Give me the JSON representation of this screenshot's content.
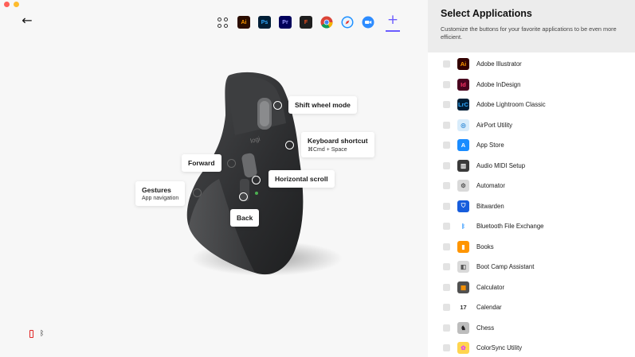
{
  "toolbar": {
    "back_label": "←",
    "apps": [
      {
        "name": "all-apps",
        "glyph": ""
      },
      {
        "name": "illustrator",
        "glyph": "Ai",
        "color": "#2b0d00",
        "fg": "#ff9a00"
      },
      {
        "name": "photoshop",
        "glyph": "Ps",
        "color": "#001e36",
        "fg": "#31a8ff"
      },
      {
        "name": "premiere",
        "glyph": "Pr",
        "color": "#00005b",
        "fg": "#9999ff"
      },
      {
        "name": "figma",
        "glyph": "F",
        "color": "#1e1e1e",
        "fg": "#f24e1e"
      },
      {
        "name": "chrome",
        "glyph": "",
        "color": "#4285f4"
      },
      {
        "name": "safari",
        "glyph": "",
        "color": "#1e90ff"
      },
      {
        "name": "zoom",
        "glyph": "",
        "color": "#2d8cff"
      }
    ],
    "add_label": "+"
  },
  "mouse": {
    "callouts": {
      "shift_wheel": {
        "label": "Shift wheel mode"
      },
      "keyboard": {
        "label": "Keyboard shortcut",
        "sub": "⌘Cmd + Space"
      },
      "forward": {
        "label": "Forward"
      },
      "horizontal": {
        "label": "Horizontal scroll"
      },
      "gestures": {
        "label": "Gestures",
        "sub": "App navigation"
      },
      "back": {
        "label": "Back"
      }
    },
    "logo_text": "logi"
  },
  "panel": {
    "title": "Select Applications",
    "description": "Customize the buttons for your favorite applications to be even more efficient.",
    "apps": [
      {
        "label": "Adobe Illustrator",
        "glyph": "Ai",
        "bg": "#330000",
        "fg": "#ff9a00"
      },
      {
        "label": "Adobe InDesign",
        "glyph": "Id",
        "bg": "#49021f",
        "fg": "#ff3366"
      },
      {
        "label": "Adobe Lightroom Classic",
        "glyph": "LrC",
        "bg": "#001e36",
        "fg": "#31a8ff"
      },
      {
        "label": "AirPort Utility",
        "glyph": "◎",
        "bg": "#d8ecfb",
        "fg": "#3a8fd8"
      },
      {
        "label": "App Store",
        "glyph": "A",
        "bg": "#1a8cff",
        "fg": "#ffffff"
      },
      {
        "label": "Audio MIDI Setup",
        "glyph": "▥",
        "bg": "#3a3a3a",
        "fg": "#eeeeee"
      },
      {
        "label": "Automator",
        "glyph": "⚙",
        "bg": "#d9d9d9",
        "fg": "#555555"
      },
      {
        "label": "Bitwarden",
        "glyph": "⛉",
        "bg": "#175ddc",
        "fg": "#ffffff"
      },
      {
        "label": "Bluetooth File Exchange",
        "glyph": "ᛒ",
        "bg": "#ffffff",
        "fg": "#1a8cff"
      },
      {
        "label": "Books",
        "glyph": "▮",
        "bg": "#ff9500",
        "fg": "#ffffff"
      },
      {
        "label": "Boot Camp Assistant",
        "glyph": "◧",
        "bg": "#d9d9d9",
        "fg": "#555555"
      },
      {
        "label": "Calculator",
        "glyph": "▦",
        "bg": "#505050",
        "fg": "#ff9500"
      },
      {
        "label": "Calendar",
        "glyph": "17",
        "bg": "#ffffff",
        "fg": "#333333"
      },
      {
        "label": "Chess",
        "glyph": "♞",
        "bg": "#bdbdbd",
        "fg": "#222222"
      },
      {
        "label": "ColorSync Utility",
        "glyph": "✿",
        "bg": "#ffd54f",
        "fg": "#e040fb"
      }
    ]
  }
}
